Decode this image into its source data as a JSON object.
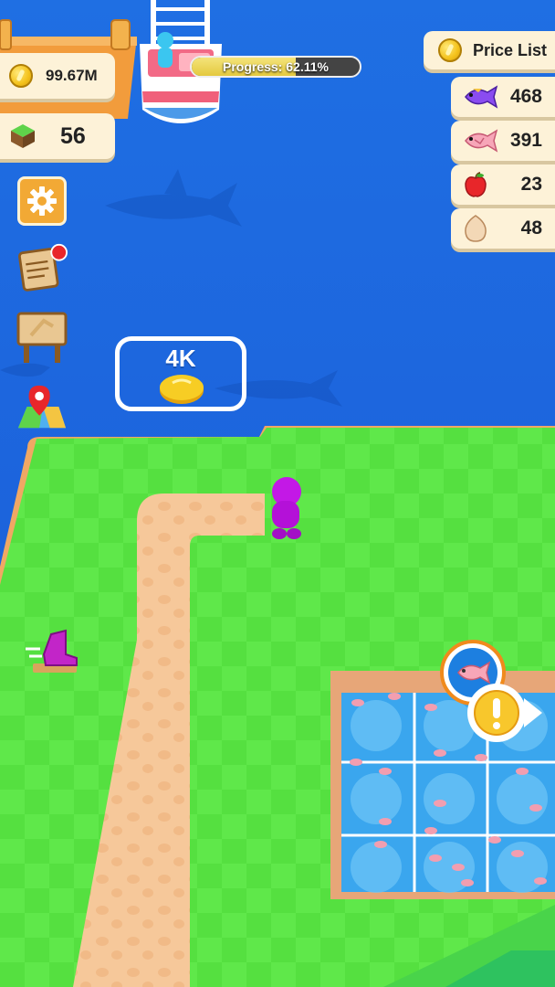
{
  "hud": {
    "coins": "99.67M",
    "blocks": "56"
  },
  "progress": {
    "label": "Progress: 62.11%",
    "fraction": 0.6211
  },
  "price_list": {
    "title": "Price List",
    "items": [
      {
        "icon": "purple-fish-icon",
        "price": "468"
      },
      {
        "icon": "pink-fish-icon",
        "price": "391"
      },
      {
        "icon": "apple-icon",
        "price": "23"
      },
      {
        "icon": "egg-icon",
        "price": "48"
      }
    ]
  },
  "unlock_zone": {
    "cost": "4K"
  },
  "side_menu": [
    "settings-icon",
    "quest-notepad-icon",
    "signboard-icon",
    "map-icon"
  ],
  "colors": {
    "ocean": "#1f6fe3",
    "grass": "#55e040",
    "path": "#f6c79a",
    "player": "#c318e6",
    "panel": "#fdf2d8"
  }
}
